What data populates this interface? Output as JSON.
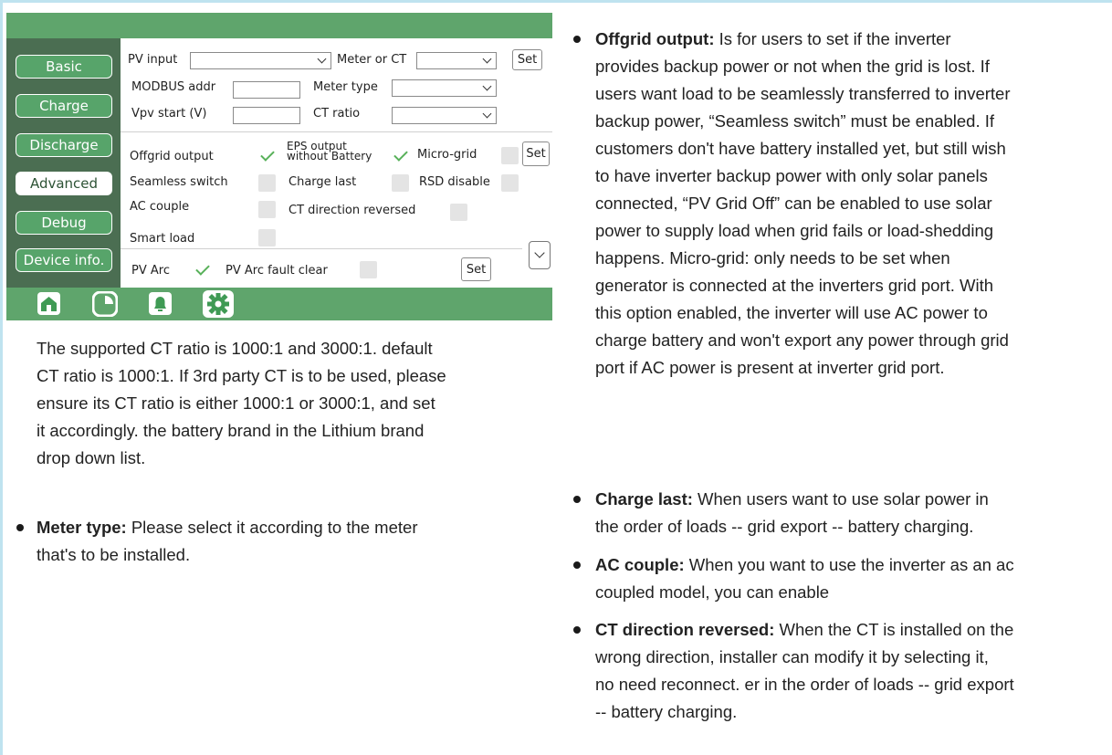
{
  "sidebar": {
    "items": [
      {
        "label": "Basic"
      },
      {
        "label": "Charge"
      },
      {
        "label": "Discharge"
      },
      {
        "label": "Advanced"
      },
      {
        "label": "Debug"
      },
      {
        "label": "Device info."
      }
    ],
    "active": "Advanced"
  },
  "form": {
    "pv_input_label": "PV input",
    "pv_input_value": "",
    "meter_or_ct_label": "Meter or CT",
    "meter_or_ct_value": "",
    "set_label": "Set",
    "modbus_label": "MODBUS addr",
    "modbus_value": "",
    "meter_type_label": "Meter type",
    "meter_type_value": "",
    "vpv_label": "Vpv start (V)",
    "vpv_value": "",
    "ct_ratio_label": "CT ratio",
    "ct_ratio_value": ""
  },
  "options": {
    "offgrid_output": {
      "label": "Offgrid output",
      "checked": true
    },
    "eps_output": {
      "label_line1": "EPS output",
      "label_line2": "without Battery",
      "checked": true
    },
    "micro_grid": {
      "label": "Micro-grid",
      "checked": false
    },
    "seamless_switch": {
      "label": "Seamless switch",
      "checked": false
    },
    "charge_last": {
      "label": "Charge last",
      "checked": false
    },
    "rsd_disable": {
      "label": "RSD disable",
      "checked": false
    },
    "ac_couple": {
      "label": "AC couple",
      "checked": false
    },
    "ct_direction": {
      "label": "CT direction reversed",
      "checked": false
    },
    "smart_load": {
      "label": "Smart load",
      "checked": false
    },
    "pv_arc": {
      "label": "PV Arc",
      "checked": true
    },
    "pv_arc_fault_clear": {
      "label": "PV Arc fault clear",
      "checked": false
    }
  },
  "bottom_icons": [
    "home-icon",
    "pie-chart-icon",
    "bell-icon",
    "gear-icon"
  ],
  "colors": {
    "accent": "#5fa56c",
    "sidebar": "#4b6e52",
    "check": "#58b15a"
  },
  "left_text": {
    "ct_ratio_para": [
      "The supported CT ratio is 1000:1 and 3000:1. default",
      "CT ratio is 1000:1. If 3rd party CT is to be used, please",
      "ensure its CT ratio is either 1000:1 or 3000:1, and set",
      "it accordingly. the battery brand in the Lithium brand",
      "drop down list."
    ],
    "meter_type_title": "Meter type:",
    "meter_type_lines": [
      " Please select it according to the meter",
      "that's to be installed."
    ]
  },
  "right_text": {
    "offgrid_title": "Offgrid output:",
    "offgrid_lines": [
      " Is for users to set if the inverter",
      "provides backup power or not when the grid is lost. If",
      "users want load to be seamlessly transferred to inverter",
      "backup power, “Seamless switch” must be enabled. If",
      "customers don't have battery installed yet, but still wish",
      "to have inverter backup power with only solar panels",
      "connected, “PV Grid Off” can be enabled to use solar",
      "power to supply load when grid fails or load-shedding",
      "happens. Micro-grid: only needs to be set when",
      "generator is connected at the inverters grid port. With",
      "this option enabled, the inverter will use AC power to",
      "charge battery and won't export any power through grid",
      "port if AC power is present at inverter grid port."
    ],
    "charge_last_title": "Charge last:",
    "charge_last_lines": [
      " When users want to use solar power in",
      "the order of loads -- grid export -- battery charging."
    ],
    "ac_couple_title": "AC couple:",
    "ac_couple_lines": [
      " When you want to use the inverter as an ac",
      "coupled model, you can enable"
    ],
    "ct_dir_title": "CT direction reversed:",
    "ct_dir_lines": [
      " When the CT is installed on the",
      "wrong direction, installer can modify it by selecting it,",
      "no need reconnect. er in the order of loads -- grid export",
      " -- battery charging."
    ]
  }
}
